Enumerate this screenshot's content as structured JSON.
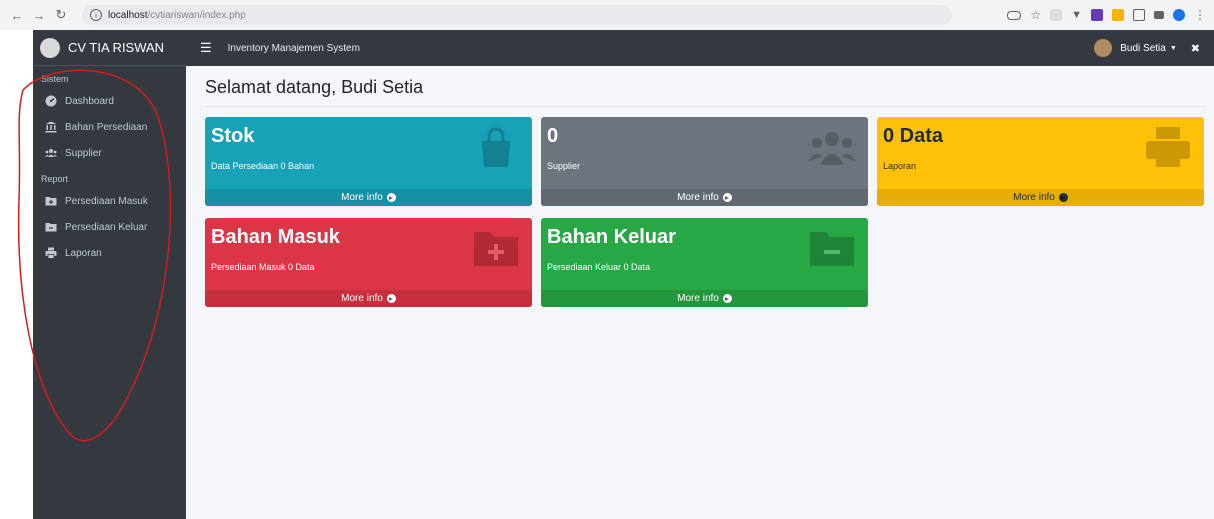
{
  "browser": {
    "url_host": "localhost",
    "url_path": "/cvtiariswan/index.php"
  },
  "sidebar": {
    "brand": "CV TIA RISWAN",
    "sections": [
      {
        "header": "Sistem"
      },
      {
        "header": "Report"
      }
    ],
    "items": [
      {
        "label": "Dashboard",
        "icon": "dashboard-icon"
      },
      {
        "label": "Bahan Persediaan",
        "icon": "building-columns-icon"
      },
      {
        "label": "Supplier",
        "icon": "users-icon"
      },
      {
        "label": "Persediaan Masuk",
        "icon": "folder-plus-icon"
      },
      {
        "label": "Persediaan Keluar",
        "icon": "folder-minus-icon"
      },
      {
        "label": "Laporan",
        "icon": "print-icon"
      }
    ]
  },
  "topbar": {
    "system_title": "Inventory Manajemen System",
    "user_name": "Budi Setia"
  },
  "main": {
    "page_title": "Selamat datang, Budi Setia",
    "cards": [
      {
        "title": "Stok",
        "desc": "Data Persediaan 0 Bahan",
        "footer": "More info",
        "color": "#17a2b8",
        "footer_color": "#1591a5",
        "text_color": "#ffffff",
        "icon": "shopping-bag-icon"
      },
      {
        "title": "0",
        "desc": "Supplier",
        "footer": "More info",
        "color": "#6c757d",
        "footer_color": "#616970",
        "text_color": "#ffffff",
        "icon": "users-icon"
      },
      {
        "title": "0 Data",
        "desc": "Laporan",
        "footer": "More info",
        "color": "#ffc107",
        "footer_color": "#e5ad06",
        "text_color": "#1f2d3d",
        "icon": "print-icon"
      },
      {
        "title": "Bahan Masuk",
        "desc": "Persediaan Masuk 0 Data",
        "footer": "More info",
        "color": "#dc3545",
        "footer_color": "#c62f3e",
        "text_color": "#ffffff",
        "icon": "folder-plus-icon"
      },
      {
        "title": "Bahan Keluar",
        "desc": "Persediaan Keluar 0 Data",
        "footer": "More info",
        "color": "#28a745",
        "footer_color": "#24963e",
        "text_color": "#ffffff",
        "icon": "folder-minus-icon"
      }
    ]
  }
}
